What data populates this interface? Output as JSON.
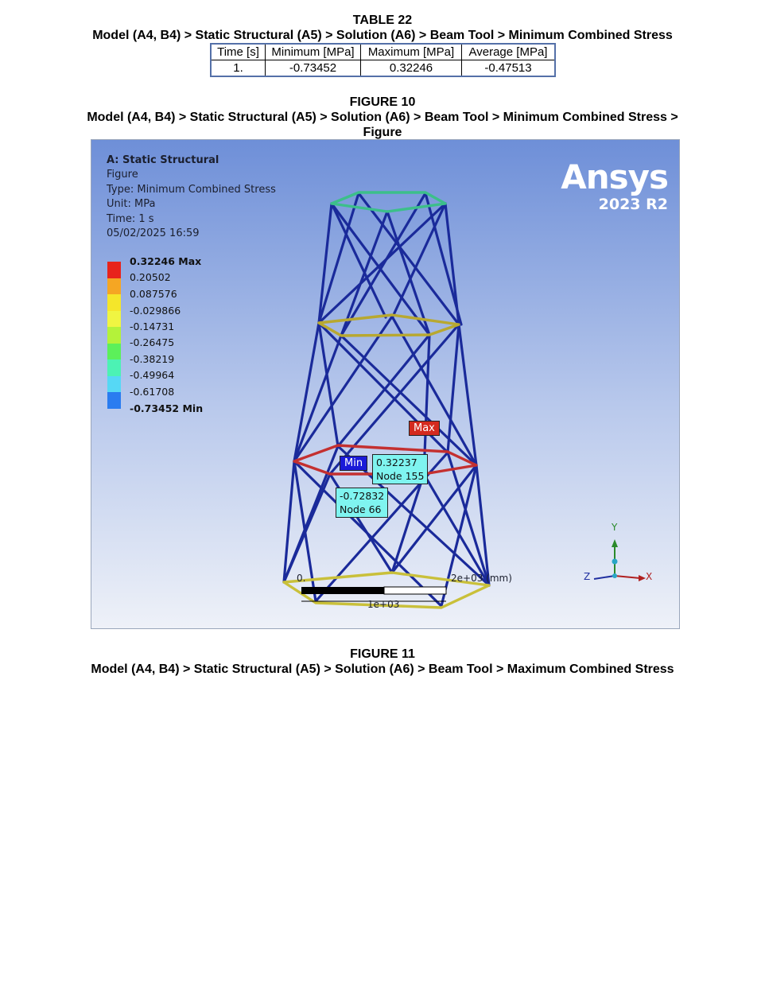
{
  "table22": {
    "title": "TABLE 22",
    "path": "Model (A4, B4) > Static Structural (A5) > Solution (A6) > Beam Tool > Minimum Combined Stress",
    "headers": [
      "Time [s]",
      "Minimum [MPa]",
      "Maximum [MPa]",
      "Average [MPa]"
    ],
    "row": [
      "1.",
      "-0.73452",
      "0.32246",
      "-0.47513"
    ]
  },
  "figure10": {
    "title": "FIGURE 10",
    "path_line1": "Model (A4, B4) > Static Structural (A5) > Solution (A6) > Beam Tool > Minimum Combined Stress >",
    "path_line2": "Figure",
    "info": {
      "analysis": "A: Static Structural",
      "name": "Figure",
      "type": "Type: Minimum Combined Stress",
      "unit": "Unit: MPa",
      "time": "Time: 1 s",
      "date": "05/02/2025 16:59"
    },
    "legend": [
      {
        "label": "0.32246 Max",
        "color": "#e8231c"
      },
      {
        "label": "0.20502",
        "color": "#f5a623"
      },
      {
        "label": "0.087576",
        "color": "#f5e62a"
      },
      {
        "label": "-0.029866",
        "color": "#f0f542"
      },
      {
        "label": "-0.14731",
        "color": "#b4f23a"
      },
      {
        "label": "-0.26475",
        "color": "#5cf05a"
      },
      {
        "label": "-0.38219",
        "color": "#4cf2b4"
      },
      {
        "label": "-0.49964",
        "color": "#56d8f5"
      },
      {
        "label": "-0.61708",
        "color": "#2a7cf0"
      },
      {
        "label": "-0.73452 Min",
        "color": "#1414d8"
      }
    ],
    "brand": "Ansys",
    "version": "2023 R2",
    "max_tag": "Max",
    "min_tag": "Min",
    "probe_max": {
      "value": "0.32237",
      "node": "Node 155"
    },
    "probe_min": {
      "value": "-0.72832",
      "node": "Node 66"
    },
    "scale": {
      "start": "0.",
      "end": "2e+03 (mm)",
      "mid": "1e+03"
    },
    "axes": {
      "x": "X",
      "y": "Y",
      "z": "Z"
    }
  },
  "figure11": {
    "title": "FIGURE 11",
    "path": "Model (A4, B4) > Static Structural (A5) > Solution (A6) > Beam Tool > Maximum Combined Stress"
  }
}
